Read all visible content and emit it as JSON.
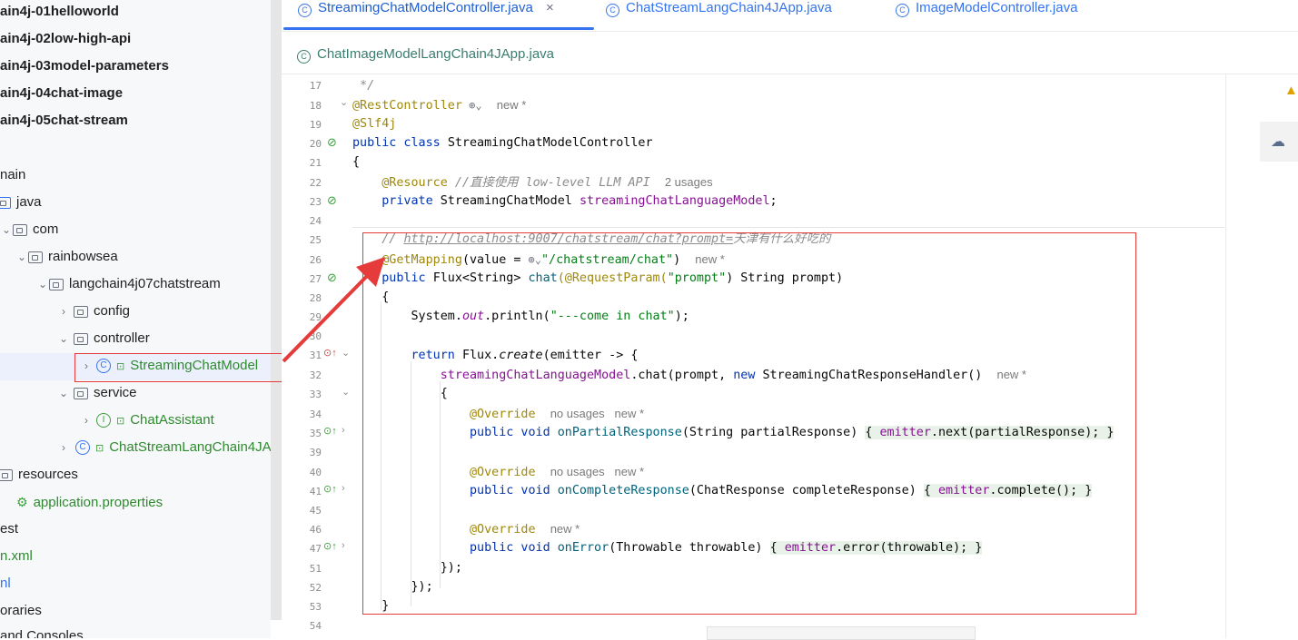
{
  "tree": {
    "items": [
      {
        "label": "ain4j-01helloworld",
        "bold": true
      },
      {
        "label": "ain4j-02low-high-api",
        "bold": true
      },
      {
        "label": "ain4j-03model-parameters",
        "bold": true
      },
      {
        "label": "ain4j-04chat-image",
        "bold": true
      },
      {
        "label": "ain4j-05chat-stream",
        "bold": true
      },
      {
        "label": "nain"
      },
      {
        "label": "java"
      },
      {
        "label": "com"
      },
      {
        "label": "rainbowsea"
      },
      {
        "label": "langchain4j07chatstream"
      },
      {
        "label": "config"
      },
      {
        "label": "controller"
      },
      {
        "label": "StreamingChatModel"
      },
      {
        "label": "service"
      },
      {
        "label": "ChatAssistant"
      },
      {
        "label": "ChatStreamLangChain4JA"
      },
      {
        "label": "resources"
      },
      {
        "label": "application.properties"
      },
      {
        "label": "est"
      },
      {
        "label": "n.xml"
      },
      {
        "label": "nl"
      },
      {
        "label": "oraries"
      },
      {
        "label": "and Consoles"
      }
    ]
  },
  "tabs": [
    {
      "label": "StreamingChatModelController.java",
      "active": true,
      "close": "×"
    },
    {
      "label": "ChatStreamLangChain4JApp.java",
      "active": false
    },
    {
      "label": "ImageModelController.java",
      "active": false
    },
    {
      "label": "ChatImageModelLangChain4JApp.java",
      "active": false
    }
  ],
  "line_numbers": [
    "17",
    "18",
    "19",
    "20",
    "21",
    "22",
    "23",
    "24",
    "25",
    "26",
    "27",
    "28",
    "29",
    "30",
    "31",
    "32",
    "33",
    "34",
    "35",
    "39",
    "40",
    "41",
    "45",
    "46",
    "47",
    "51",
    "52",
    "53",
    "54"
  ],
  "code": {
    "l17": " */",
    "l18_ann": "@RestController",
    "l18_hint": "new *",
    "l19": "@Slf4j",
    "l20_kw": "public class ",
    "l20_name": "StreamingChatModelController",
    "l21": "{",
    "l22_ann": "@Resource",
    "l22_cm": "//直接使用 low-level LLM API",
    "l22_hint": "2 usages",
    "l23_kw": "private ",
    "l23_type": "StreamingChatModel ",
    "l23_fld": "streamingChatLanguageModel",
    "l23_end": ";",
    "l25_cm": "// ",
    "l25_url": "http://localhost:9007/chatstream/chat?prompt=",
    "l25_tail": "天津有什么好吃的",
    "l26_ann": "@GetMapping",
    "l26_a": "(value = ",
    "l26_str": "\"/chatstream/chat\"",
    "l26_b": ")",
    "l26_hint": "new *",
    "l27_kw": "public ",
    "l27_a": "Flux<String> ",
    "l27_meth": "chat",
    "l27_ann": "(@RequestParam(",
    "l27_str": "\"prompt\"",
    "l27_b": ") String prompt)",
    "l28": "{",
    "l29_a": "System.",
    "l29_out": "out",
    "l29_b": ".println(",
    "l29_str": "\"---come in chat\"",
    "l29_c": ");",
    "l31_kw": "return ",
    "l31_a": "Flux.",
    "l31_create": "create",
    "l31_b": "(emitter -> {",
    "l32_fld": "streamingChatLanguageModel",
    "l32_a": ".chat(prompt, ",
    "l32_kw": "new ",
    "l32_b": "StreamingChatResponseHandler()",
    "l32_hint": "new *",
    "l33": "{",
    "l34_ann": "@Override",
    "l34_hint": "no usages   new *",
    "l35_kw": "public void ",
    "l35_meth": "onPartialResponse",
    "l35_a": "(String partialResponse) ",
    "l35_b": "{ ",
    "l35_fld": "emitter",
    "l35_c": ".next(partialResponse); }",
    "l40_ann": "@Override",
    "l40_hint": "no usages   new *",
    "l41_kw": "public void ",
    "l41_meth": "onCompleteResponse",
    "l41_a": "(ChatResponse completeResponse) ",
    "l41_b": "{ ",
    "l41_fld": "emitter",
    "l41_c": ".complete(); }",
    "l46_ann": "@Override",
    "l46_hint": "new *",
    "l47_kw": "public void ",
    "l47_meth": "onError",
    "l47_a": "(Throwable throwable) ",
    "l47_b": "{ ",
    "l47_fld": "emitter",
    "l47_c": ".error(throwable); }",
    "l51": "});",
    "l52": "});",
    "l53": "}"
  },
  "colors": {
    "annotation_box": "#e53b3b",
    "arrow": "#e53b3b",
    "tab_active_underline": "#3574f0"
  },
  "icons": [
    "class-icon",
    "interface-icon",
    "folder-icon",
    "globe-icon",
    "warning-icon",
    "ai-assistant-icon",
    "spring-bean-icon"
  ]
}
